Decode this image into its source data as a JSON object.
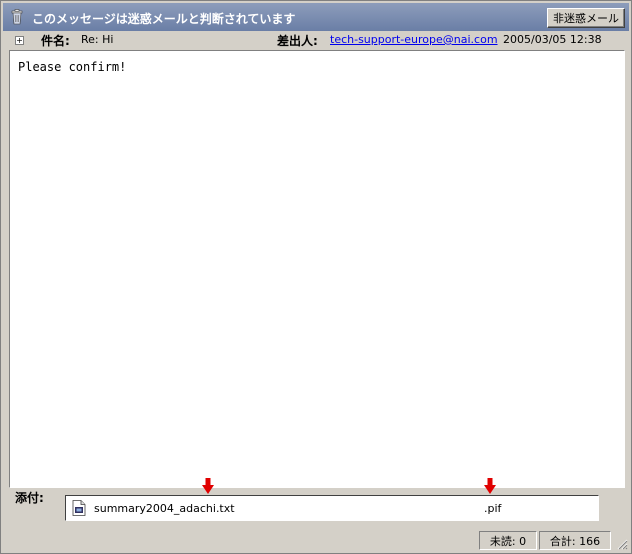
{
  "banner": {
    "title": "このメッセージは迷惑メールと判断されています",
    "not_junk_button": "非迷惑メール"
  },
  "header": {
    "expander_symbol": "+",
    "subject_label": "件名:",
    "subject_value": "Re: Hi",
    "from_label": "差出人:",
    "from_value": "tech-support-europe@nai.com",
    "date_value": "2005/03/05 12:38"
  },
  "body": {
    "text": "Please confirm!"
  },
  "attachments": {
    "label": "添付:",
    "file_name": "summary2004_adachi.txt",
    "hidden_extension": ".pif",
    "arrow_color": "#e00000"
  },
  "status": {
    "unread": "未読: 0",
    "total": "合計: 166"
  }
}
